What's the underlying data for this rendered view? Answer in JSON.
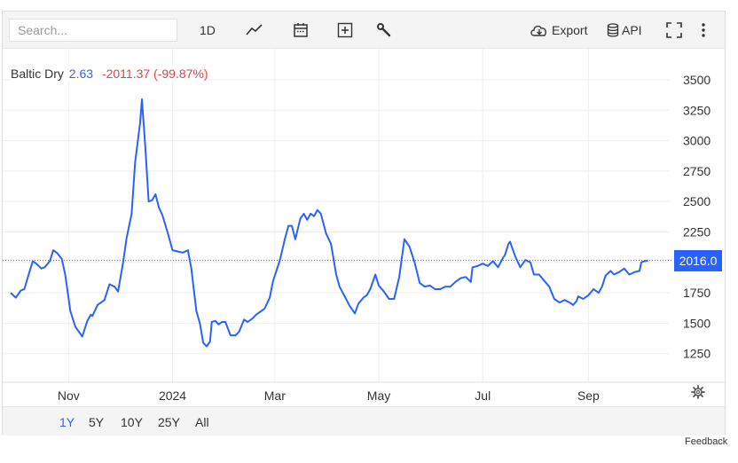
{
  "toolbar": {
    "search_placeholder": "Search...",
    "interval_label": "1D",
    "export_label": "Export",
    "api_label": "API",
    "icons": [
      "line-chart-icon",
      "calendar-icon",
      "plus-box-icon",
      "wrench-icon",
      "cloud-download-icon",
      "database-icon",
      "fullscreen-icon",
      "more-vertical-icon"
    ]
  },
  "legend": {
    "name": "Baltic Dry",
    "last": "2.63",
    "change": "-2011.37 (-99.87%)"
  },
  "price_tag": "2016.0",
  "range_buttons": [
    "1Y",
    "5Y",
    "10Y",
    "25Y",
    "All"
  ],
  "active_range": "1Y",
  "feedback": "Feedback",
  "colors": {
    "line": "#2962ff",
    "negative": "#e0463f",
    "grid": "#eeeeee"
  },
  "chart_data": {
    "type": "line",
    "series": [
      {
        "name": "Baltic Dry",
        "points": [
          [
            "2023-09-28",
            1750
          ],
          [
            "2023-10-01",
            1710
          ],
          [
            "2023-10-04",
            1770
          ],
          [
            "2023-10-06",
            1780
          ],
          [
            "2023-10-09",
            1920
          ],
          [
            "2023-10-11",
            2010
          ],
          [
            "2023-10-13",
            1990
          ],
          [
            "2023-10-16",
            1950
          ],
          [
            "2023-10-18",
            1960
          ],
          [
            "2023-10-21",
            2010
          ],
          [
            "2023-10-23",
            2100
          ],
          [
            "2023-10-25",
            2080
          ],
          [
            "2023-10-28",
            2030
          ],
          [
            "2023-10-30",
            1900
          ],
          [
            "2023-11-02",
            1600
          ],
          [
            "2023-11-05",
            1470
          ],
          [
            "2023-11-08",
            1410
          ],
          [
            "2023-11-09",
            1390
          ],
          [
            "2023-11-12",
            1520
          ],
          [
            "2023-11-14",
            1570
          ],
          [
            "2023-11-15",
            1560
          ],
          [
            "2023-11-18",
            1650
          ],
          [
            "2023-11-20",
            1670
          ],
          [
            "2023-11-22",
            1690
          ],
          [
            "2023-11-25",
            1820
          ],
          [
            "2023-11-28",
            1800
          ],
          [
            "2023-11-30",
            1760
          ],
          [
            "2023-12-03",
            2000
          ],
          [
            "2023-12-05",
            2200
          ],
          [
            "2023-12-08",
            2400
          ],
          [
            "2023-12-10",
            2820
          ],
          [
            "2023-12-13",
            3150
          ],
          [
            "2023-12-14",
            3340
          ],
          [
            "2023-12-16",
            2950
          ],
          [
            "2023-12-18",
            2500
          ],
          [
            "2023-12-20",
            2510
          ],
          [
            "2023-12-22",
            2560
          ],
          [
            "2023-12-24",
            2450
          ],
          [
            "2023-12-26",
            2390
          ],
          [
            "2023-12-29",
            2250
          ],
          [
            "2024-01-01",
            2100
          ],
          [
            "2024-01-04",
            2090
          ],
          [
            "2024-01-07",
            2080
          ],
          [
            "2024-01-10",
            2100
          ],
          [
            "2024-01-12",
            1950
          ],
          [
            "2024-01-15",
            1600
          ],
          [
            "2024-01-17",
            1500
          ],
          [
            "2024-01-19",
            1340
          ],
          [
            "2024-01-21",
            1310
          ],
          [
            "2024-01-23",
            1350
          ],
          [
            "2024-01-24",
            1510
          ],
          [
            "2024-01-26",
            1520
          ],
          [
            "2024-01-28",
            1490
          ],
          [
            "2024-01-30",
            1510
          ],
          [
            "2024-02-01",
            1510
          ],
          [
            "2024-02-04",
            1400
          ],
          [
            "2024-02-07",
            1400
          ],
          [
            "2024-02-09",
            1430
          ],
          [
            "2024-02-12",
            1530
          ],
          [
            "2024-02-14",
            1510
          ],
          [
            "2024-02-17",
            1540
          ],
          [
            "2024-02-19",
            1570
          ],
          [
            "2024-02-22",
            1600
          ],
          [
            "2024-02-24",
            1620
          ],
          [
            "2024-02-27",
            1710
          ],
          [
            "2024-02-29",
            1850
          ],
          [
            "2024-03-01",
            1890
          ],
          [
            "2024-03-04",
            2020
          ],
          [
            "2024-03-07",
            2200
          ],
          [
            "2024-03-09",
            2300
          ],
          [
            "2024-03-11",
            2300
          ],
          [
            "2024-03-13",
            2190
          ],
          [
            "2024-03-16",
            2360
          ],
          [
            "2024-03-18",
            2400
          ],
          [
            "2024-03-20",
            2350
          ],
          [
            "2024-03-22",
            2400
          ],
          [
            "2024-03-24",
            2380
          ],
          [
            "2024-03-26",
            2430
          ],
          [
            "2024-03-28",
            2400
          ],
          [
            "2024-03-31",
            2240
          ],
          [
            "2024-04-03",
            2150
          ],
          [
            "2024-04-06",
            1900
          ],
          [
            "2024-04-08",
            1800
          ],
          [
            "2024-04-11",
            1720
          ],
          [
            "2024-04-14",
            1640
          ],
          [
            "2024-04-17",
            1580
          ],
          [
            "2024-04-19",
            1660
          ],
          [
            "2024-04-22",
            1710
          ],
          [
            "2024-04-24",
            1730
          ],
          [
            "2024-04-26",
            1780
          ],
          [
            "2024-04-29",
            1900
          ],
          [
            "2024-05-01",
            1810
          ],
          [
            "2024-05-04",
            1760
          ],
          [
            "2024-05-07",
            1700
          ],
          [
            "2024-05-10",
            1700
          ],
          [
            "2024-05-13",
            1880
          ],
          [
            "2024-05-16",
            2190
          ],
          [
            "2024-05-19",
            2130
          ],
          [
            "2024-05-22",
            2000
          ],
          [
            "2024-05-25",
            1830
          ],
          [
            "2024-05-28",
            1800
          ],
          [
            "2024-05-31",
            1810
          ],
          [
            "2024-06-03",
            1780
          ],
          [
            "2024-06-06",
            1780
          ],
          [
            "2024-06-09",
            1800
          ],
          [
            "2024-06-12",
            1800
          ],
          [
            "2024-06-15",
            1840
          ],
          [
            "2024-06-18",
            1870
          ],
          [
            "2024-06-21",
            1880
          ],
          [
            "2024-06-24",
            1840
          ],
          [
            "2024-06-25",
            1960
          ],
          [
            "2024-06-28",
            1970
          ],
          [
            "2024-07-01",
            1990
          ],
          [
            "2024-07-04",
            1970
          ],
          [
            "2024-07-07",
            2010
          ],
          [
            "2024-07-10",
            1960
          ],
          [
            "2024-07-13",
            2040
          ],
          [
            "2024-07-14",
            2060
          ],
          [
            "2024-07-16",
            2150
          ],
          [
            "2024-07-17",
            2170
          ],
          [
            "2024-07-20",
            2050
          ],
          [
            "2024-07-23",
            1960
          ],
          [
            "2024-07-26",
            2020
          ],
          [
            "2024-07-29",
            2000
          ],
          [
            "2024-07-31",
            1900
          ],
          [
            "2024-08-03",
            1900
          ],
          [
            "2024-08-06",
            1850
          ],
          [
            "2024-08-09",
            1800
          ],
          [
            "2024-08-12",
            1700
          ],
          [
            "2024-08-15",
            1670
          ],
          [
            "2024-08-18",
            1690
          ],
          [
            "2024-08-21",
            1670
          ],
          [
            "2024-08-23",
            1650
          ],
          [
            "2024-08-25",
            1680
          ],
          [
            "2024-08-26",
            1720
          ],
          [
            "2024-08-29",
            1700
          ],
          [
            "2024-09-01",
            1730
          ],
          [
            "2024-09-04",
            1780
          ],
          [
            "2024-09-07",
            1750
          ],
          [
            "2024-09-09",
            1800
          ],
          [
            "2024-09-11",
            1890
          ],
          [
            "2024-09-14",
            1930
          ],
          [
            "2024-09-16",
            1900
          ],
          [
            "2024-09-19",
            1920
          ],
          [
            "2024-09-22",
            1950
          ],
          [
            "2024-09-25",
            1900
          ],
          [
            "2024-09-28",
            1920
          ],
          [
            "2024-10-01",
            1930
          ],
          [
            "2024-10-02",
            2000
          ],
          [
            "2024-10-04",
            2010
          ],
          [
            "2024-10-06",
            2016
          ]
        ]
      }
    ],
    "x_ticks": [
      {
        "label": "Nov",
        "date": "2023-11-01"
      },
      {
        "label": "2024",
        "date": "2024-01-01"
      },
      {
        "label": "Mar",
        "date": "2024-03-01"
      },
      {
        "label": "May",
        "date": "2024-05-01"
      },
      {
        "label": "Jul",
        "date": "2024-07-01"
      },
      {
        "label": "Sep",
        "date": "2024-09-01"
      }
    ],
    "y_ticks": [
      1250,
      1500,
      1750,
      2000,
      2250,
      2500,
      2750,
      3000,
      3250,
      3500
    ],
    "y_tick_labels": [
      "1250",
      "1500",
      "1750",
      "",
      "2250",
      "2500",
      "2750",
      "3000",
      "3250",
      "3500"
    ],
    "x_range": [
      "2023-09-28",
      "2024-10-14"
    ],
    "ylim": [
      1000,
      3550
    ],
    "last_value": 2016,
    "grid": true
  }
}
